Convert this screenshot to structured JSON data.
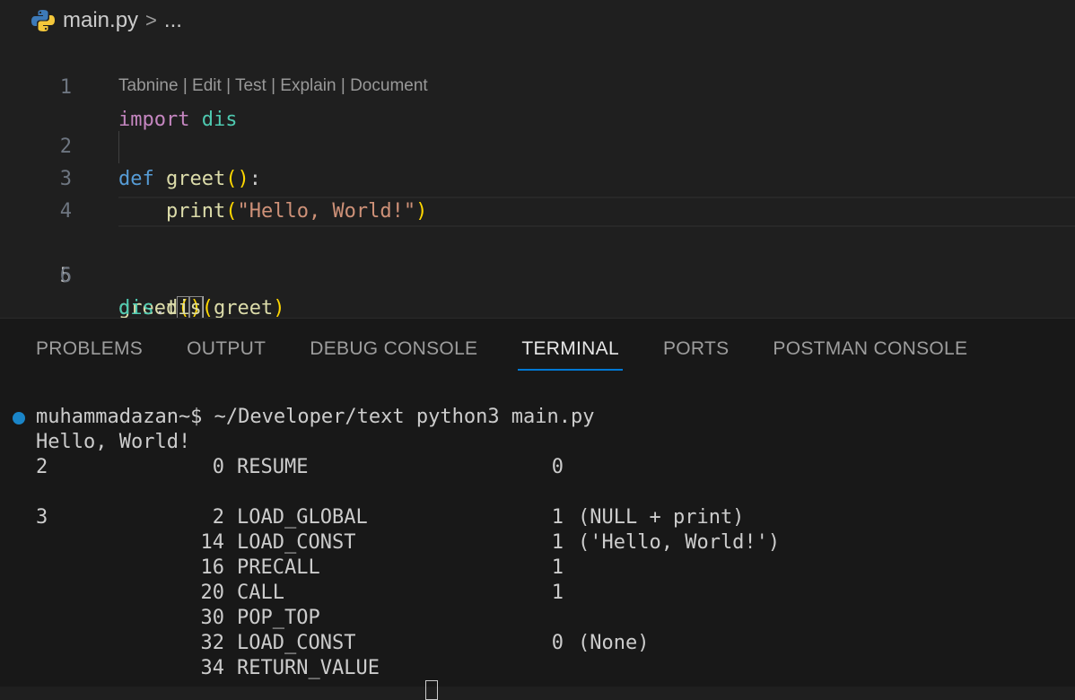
{
  "breadcrumb": {
    "file": "main.py",
    "separator": ">",
    "more": "..."
  },
  "codelens": {
    "text": "Tabnine | Edit | Test | Explain | Document"
  },
  "editor": {
    "line_numbers": [
      "1",
      "2",
      "3",
      "4",
      "5",
      "6"
    ],
    "line1": {
      "kw": "import",
      "mod": "dis"
    },
    "line2": {
      "kw": "def",
      "fn": "greet",
      "paren": "()",
      "colon": ":"
    },
    "line3": {
      "indent": "    ",
      "fn": "print",
      "open": "(",
      "str": "\"Hello, World!\"",
      "close": ")"
    },
    "line5": {
      "fn": "greet",
      "open": "(",
      "close": ")"
    },
    "line6": {
      "mod": "dis",
      "dot": ".",
      "fn": "dis",
      "open": "(",
      "arg": "greet",
      "close": ")"
    }
  },
  "panel": {
    "tabs": [
      "PROBLEMS",
      "OUTPUT",
      "DEBUG CONSOLE",
      "TERMINAL",
      "PORTS",
      "POSTMAN CONSOLE"
    ],
    "active_tab": "TERMINAL"
  },
  "terminal": {
    "prompt": "muhammadazan~$ ~/Developer/text python3 main.py",
    "output": "Hello, World!",
    "bytecode": [
      {
        "line": "2",
        "offset": "0",
        "op": "RESUME",
        "arg": "0",
        "desc": ""
      },
      {
        "line": "3",
        "offset": "2",
        "op": "LOAD_GLOBAL",
        "arg": "1",
        "desc": "(NULL + print)"
      },
      {
        "line": "",
        "offset": "14",
        "op": "LOAD_CONST",
        "arg": "1",
        "desc": "('Hello, World!')"
      },
      {
        "line": "",
        "offset": "16",
        "op": "PRECALL",
        "arg": "1",
        "desc": ""
      },
      {
        "line": "",
        "offset": "20",
        "op": "CALL",
        "arg": "1",
        "desc": ""
      },
      {
        "line": "",
        "offset": "30",
        "op": "POP_TOP",
        "arg": "",
        "desc": ""
      },
      {
        "line": "",
        "offset": "32",
        "op": "LOAD_CONST",
        "arg": "0",
        "desc": "(None)"
      },
      {
        "line": "",
        "offset": "34",
        "op": "RETURN_VALUE",
        "arg": "",
        "desc": ""
      }
    ]
  },
  "colors": {
    "accent": "#0078d4",
    "dot": "#1a85c8"
  }
}
